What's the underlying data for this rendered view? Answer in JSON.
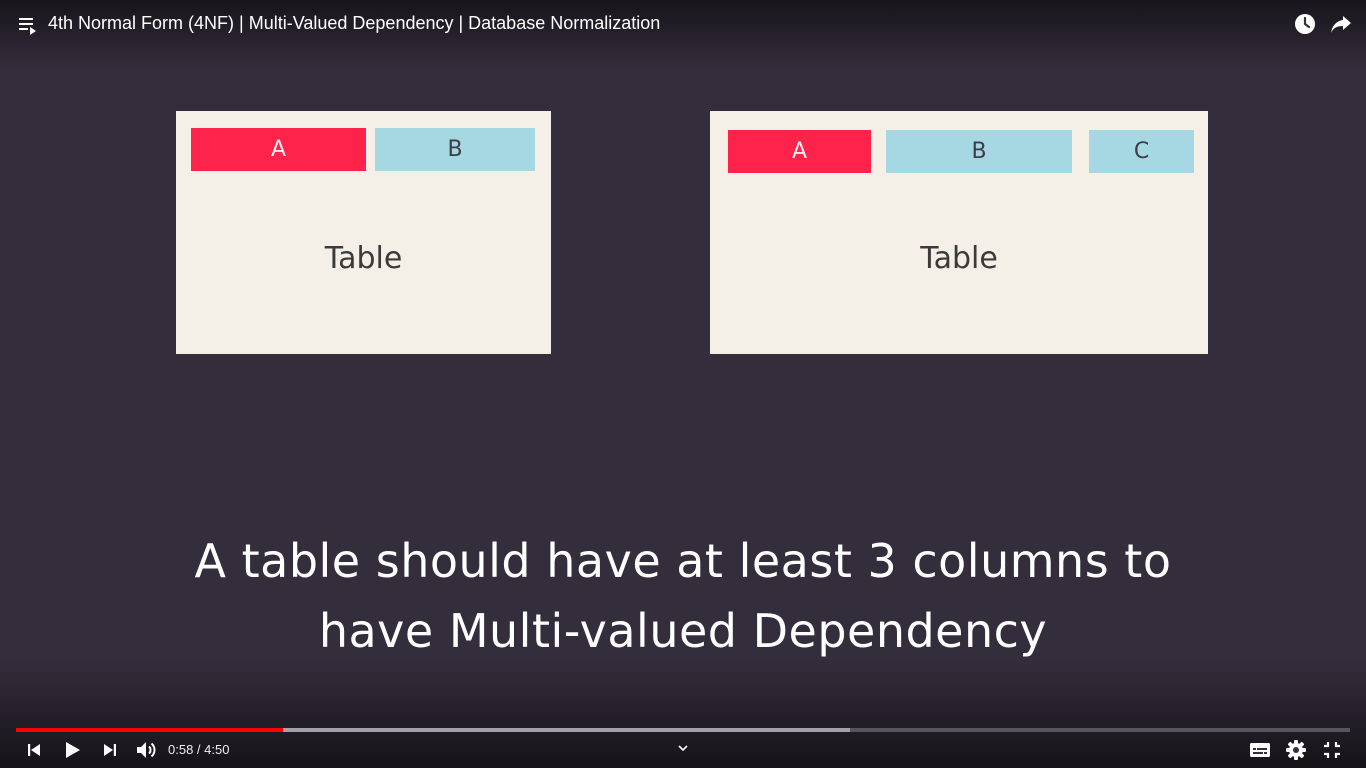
{
  "header": {
    "title": "4th Normal Form (4NF) | Multi-Valued Dependency | Database Normalization",
    "icons": [
      "playlist-icon",
      "watch-later-icon",
      "share-icon"
    ]
  },
  "slide": {
    "left_table": {
      "columns": [
        "A",
        "B"
      ],
      "label": "Table"
    },
    "right_table": {
      "columns": [
        "A",
        "B",
        "C"
      ],
      "label": "Table"
    },
    "caption_line1": "A table should have at least 3 columns to",
    "caption_line2": "have Multi-valued Dependency",
    "colors": {
      "background": "#342e3c",
      "card": "#f4f0e8",
      "column_red": "#fe234b",
      "column_blue": "#a5d8e3"
    }
  },
  "player": {
    "current_time": "0:58",
    "separator": " / ",
    "duration": "4:50",
    "played_fraction": 0.2,
    "buffered_fraction": 0.625,
    "progress_color": "#ff0000",
    "icons": [
      "previous-icon",
      "play-icon",
      "next-icon",
      "volume-icon",
      "chevron-down-icon",
      "captions-icon",
      "settings-icon",
      "exit-fullscreen-icon"
    ]
  }
}
